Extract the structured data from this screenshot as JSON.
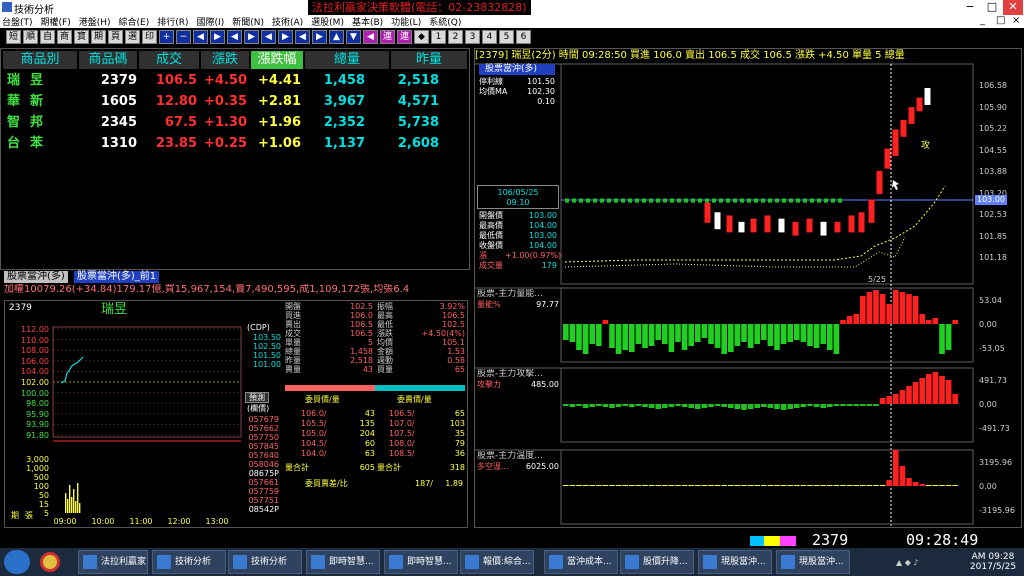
{
  "window": {
    "title": "技術分析",
    "banner": "法拉利贏家決策軟體(電話：02-23832828)",
    "min": "−",
    "max": "□",
    "close": "✕"
  },
  "menu": [
    "台盤(T)",
    "期權(F)",
    "港盤(H)",
    "綜合(E)",
    "排行(R)",
    "國際(I)",
    "新聞(N)",
    "技術(A)",
    "選股(M)",
    "基本(B)",
    "功能(L)",
    "系統(Q)"
  ],
  "menu_right": {
    "min": "_",
    "max": "□",
    "close": "×"
  },
  "toolbar": [
    "短",
    "順",
    "自",
    "商",
    "寶",
    "期",
    "頁",
    "選",
    "印",
    "+",
    "−",
    "◀",
    "▶",
    "◀",
    "▶",
    "◀",
    "▶",
    "◀",
    "▶",
    "▲",
    "▼",
    "◀",
    "連",
    "連",
    "◆",
    "1",
    "2",
    "3",
    "4",
    "5",
    "6"
  ],
  "quote": {
    "headers": [
      "商品別",
      "商品碼",
      "成交",
      "漲跌",
      "漲跌幅",
      "總量",
      "昨量"
    ],
    "rows": [
      {
        "name": "瑞昱",
        "code": "2379",
        "price": "106.5",
        "chg": "+4.50",
        "pct": "+4.41",
        "vol": "1,458",
        "prev": "2,518"
      },
      {
        "name": "華新",
        "code": "1605",
        "price": "12.80",
        "chg": "+0.35",
        "pct": "+2.81",
        "vol": "3,967",
        "prev": "4,571"
      },
      {
        "name": "智邦",
        "code": "2345",
        "price": "67.5",
        "chg": "+1.30",
        "pct": "+1.96",
        "vol": "2,352",
        "prev": "5,738"
      },
      {
        "name": "台苯",
        "code": "1310",
        "price": "23.85",
        "chg": "+0.25",
        "pct": "+1.06",
        "vol": "1,137",
        "prev": "2,608"
      }
    ]
  },
  "tabs": {
    "t1": "股票當沖(多)",
    "t2": "股票當沖(多)_前1"
  },
  "ticker": "加權10079.26(+34.84)179.17億,買15,967,154,賣7,490,595,成1,109,172張,均張6.4",
  "stock": {
    "code": "2379",
    "name": "瑞昱",
    "prices": [
      "112.00",
      "110.00",
      "108.00",
      "106.00",
      "104.00",
      "102.00",
      "100.00",
      "98.00",
      "95.90",
      "93.90",
      "91.80"
    ],
    "vols": [
      "3,000",
      "1,000",
      "500",
      "100",
      "50",
      "15",
      "5"
    ],
    "vlabel": "張",
    "vlabel2": "期",
    "cdp_title": "(CDP)",
    "cdp": [
      "103.50",
      "102.50",
      "101.50",
      "101.00"
    ],
    "predict_label": "預測",
    "level_label": "(欄價)",
    "ticks": [
      "057679",
      "057662",
      "057750",
      "057845",
      "057640",
      "058046",
      "08675P",
      "057661",
      "057759",
      "057751",
      "08542P"
    ],
    "times": [
      "09:00",
      "10:00",
      "11:00",
      "12:00",
      "13:00"
    ],
    "info_left": [
      [
        "開盤",
        "102.5"
      ],
      [
        "買進",
        "106.0"
      ],
      [
        "賣出",
        "106.5"
      ],
      [
        "成交",
        "106.5"
      ],
      [
        "單量",
        "5"
      ],
      [
        "總量",
        "1,458"
      ],
      [
        "昨量",
        "2,518"
      ],
      [
        "賣量",
        "43"
      ]
    ],
    "info_right": [
      [
        "振幅",
        "3.92%"
      ],
      [
        "最高",
        "106.5"
      ],
      [
        "最低",
        "102.5"
      ],
      [
        "漲跌",
        "+4.50(4%)"
      ],
      [
        "均價",
        "105.1"
      ],
      [
        "金額",
        "1.53"
      ],
      [
        "週動",
        "0.58"
      ],
      [
        "買量",
        "65"
      ]
    ],
    "book_hdr": [
      "委買價/量",
      "委賣價/量"
    ],
    "book": [
      [
        "106.0/",
        "43",
        "106.5/",
        "65"
      ],
      [
        "105.5/",
        "135",
        "107.0/",
        "103"
      ],
      [
        "105.0/",
        "204",
        "107.5/",
        "35"
      ],
      [
        "104.5/",
        "60",
        "108.0/",
        "79"
      ],
      [
        "104.0/",
        "63",
        "108.5/",
        "36"
      ]
    ],
    "totals": [
      "量合計",
      "605",
      "量合計",
      "318"
    ],
    "ratio": [
      "委買賣差/比",
      "187/",
      "1.89"
    ]
  },
  "chart": {
    "header": "[2379] 瑞昱(2分) 時間 09:28:50   買進 106.0   賣出 106.5   成交 106.5   漲跌 +4.50   單量 5   總量",
    "legend_title": "股票當沖(多)",
    "legend": [
      [
        "停利線",
        "101.50"
      ],
      [
        "均價MA",
        "102.30"
      ],
      [
        "",
        "0.10"
      ]
    ],
    "date_box": [
      "106/05/25",
      "09:10"
    ],
    "box": [
      [
        "開盤價",
        "103.00"
      ],
      [
        "最高價",
        "104.00"
      ],
      [
        "最低價",
        "103.00"
      ],
      [
        "收盤價",
        "104.00"
      ],
      [
        "漲",
        "+1.00(0.97%)"
      ],
      [
        "成交量",
        "179"
      ]
    ],
    "price_axis": [
      "106.58",
      "105.90",
      "105.22",
      "104.55",
      "103.88",
      "103.20",
      "102.53",
      "101.85",
      "101.18"
    ],
    "current": "103.00",
    "date_label": "5/25",
    "attack_mark": "攻",
    "sub1": {
      "title": "股票-主力量能...",
      "label": "量能%",
      "value": "97.77",
      "axis": [
        "53.04",
        "0.00",
        "-53.05"
      ]
    },
    "sub2": {
      "title": "股票-主力攻擊...",
      "label": "攻擊力",
      "value": "485.00",
      "axis": [
        "491.73",
        "0.00",
        "-491.73"
      ]
    },
    "sub3": {
      "title": "股票-主力溫度...",
      "label": "多空溫...",
      "value": "6025.00",
      "axis": [
        "3195.96",
        "0.00",
        "-3195.96"
      ]
    }
  },
  "status": {
    "code": "2379",
    "time": "09:28:49"
  },
  "taskbar": {
    "items": [
      "法拉利贏家",
      "技術分析",
      "技術分析",
      "即時智慧...",
      "即時智慧...",
      "報價:綜合...",
      "當沖成本...",
      "股價升降...",
      "現股當沖...",
      "現股當沖..."
    ],
    "clock_time": "AM 09:28",
    "clock_date": "2017/5/25"
  },
  "colors": {
    "red": "#ff2020",
    "green": "#20c020",
    "yellow": "#ffff40",
    "cyan": "#00e0e0"
  }
}
